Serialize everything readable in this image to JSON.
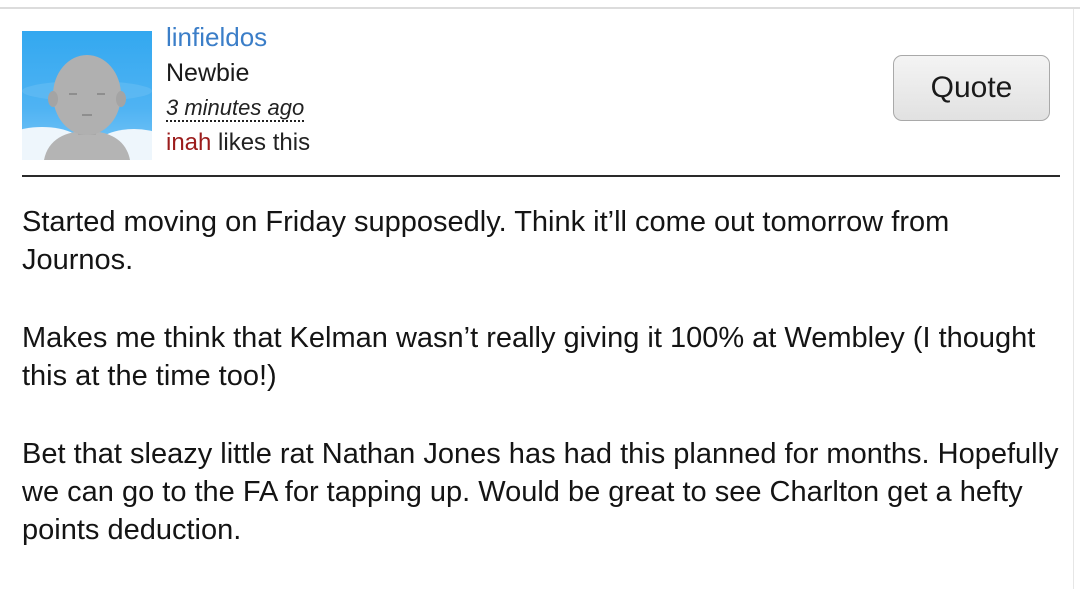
{
  "post": {
    "author": {
      "name": "linfieldos",
      "rank": "Newbie",
      "avatar_icon": "default-user-avatar-icon"
    },
    "timestamp": "3 minutes ago",
    "likes": {
      "user": "inah",
      "suffix": " likes this"
    },
    "quote_label": "Quote",
    "body": [
      "Started moving on Friday supposedly. Think it’ll come out tomorrow from Journos.",
      "Makes me think that Kelman wasn’t really giving it 100% at Wembley (I thought this at the time too!)",
      "Bet that sleazy little rat Nathan Jones has had this planned for months. Hopefully we can go to the FA for tapping up. Would be great to see Charlton get a hefty points deduction."
    ]
  },
  "colors": {
    "author_link": "#3b7ec8",
    "liker_link": "#9b1c1c",
    "avatar_sky": "#33a8f0",
    "divider": "#2a2a2a"
  }
}
